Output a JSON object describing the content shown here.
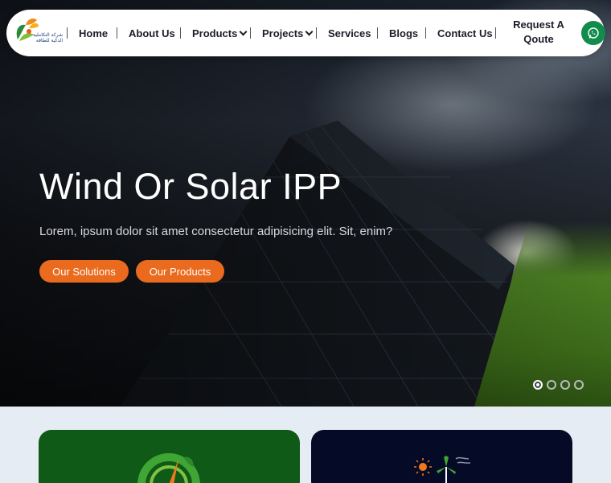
{
  "nav": {
    "items": [
      {
        "label": "Home",
        "dropdown": false
      },
      {
        "label": "About Us",
        "dropdown": false
      },
      {
        "label": "Products",
        "dropdown": true
      },
      {
        "label": "Projects",
        "dropdown": true
      },
      {
        "label": "Services",
        "dropdown": false
      },
      {
        "label": "Blogs",
        "dropdown": false
      },
      {
        "label": "Contact Us",
        "dropdown": false
      }
    ],
    "quote_label": "Request A Qoute",
    "logo_text": "شركة التكاملية الذكية للطاقة"
  },
  "hero": {
    "title": "Wind Or Solar IPP",
    "subtitle": "Lorem, ipsum dolor sit amet consectetur adipisicing elit. Sit, enim?",
    "buttons": [
      "Our Solutions",
      "Our Products"
    ],
    "slides_total": 4,
    "slide_active": 1
  },
  "icons": {
    "whatsapp": "whatsapp-icon",
    "card1": "gauge-leaf-icon",
    "card2": "wind-solar-icon"
  },
  "colors": {
    "accent": "#ea6a1e",
    "whatsapp": "#128c4b",
    "card_green": "#0e5a16",
    "card_navy": "#050a26",
    "nav_text": "#1d1d2b"
  }
}
